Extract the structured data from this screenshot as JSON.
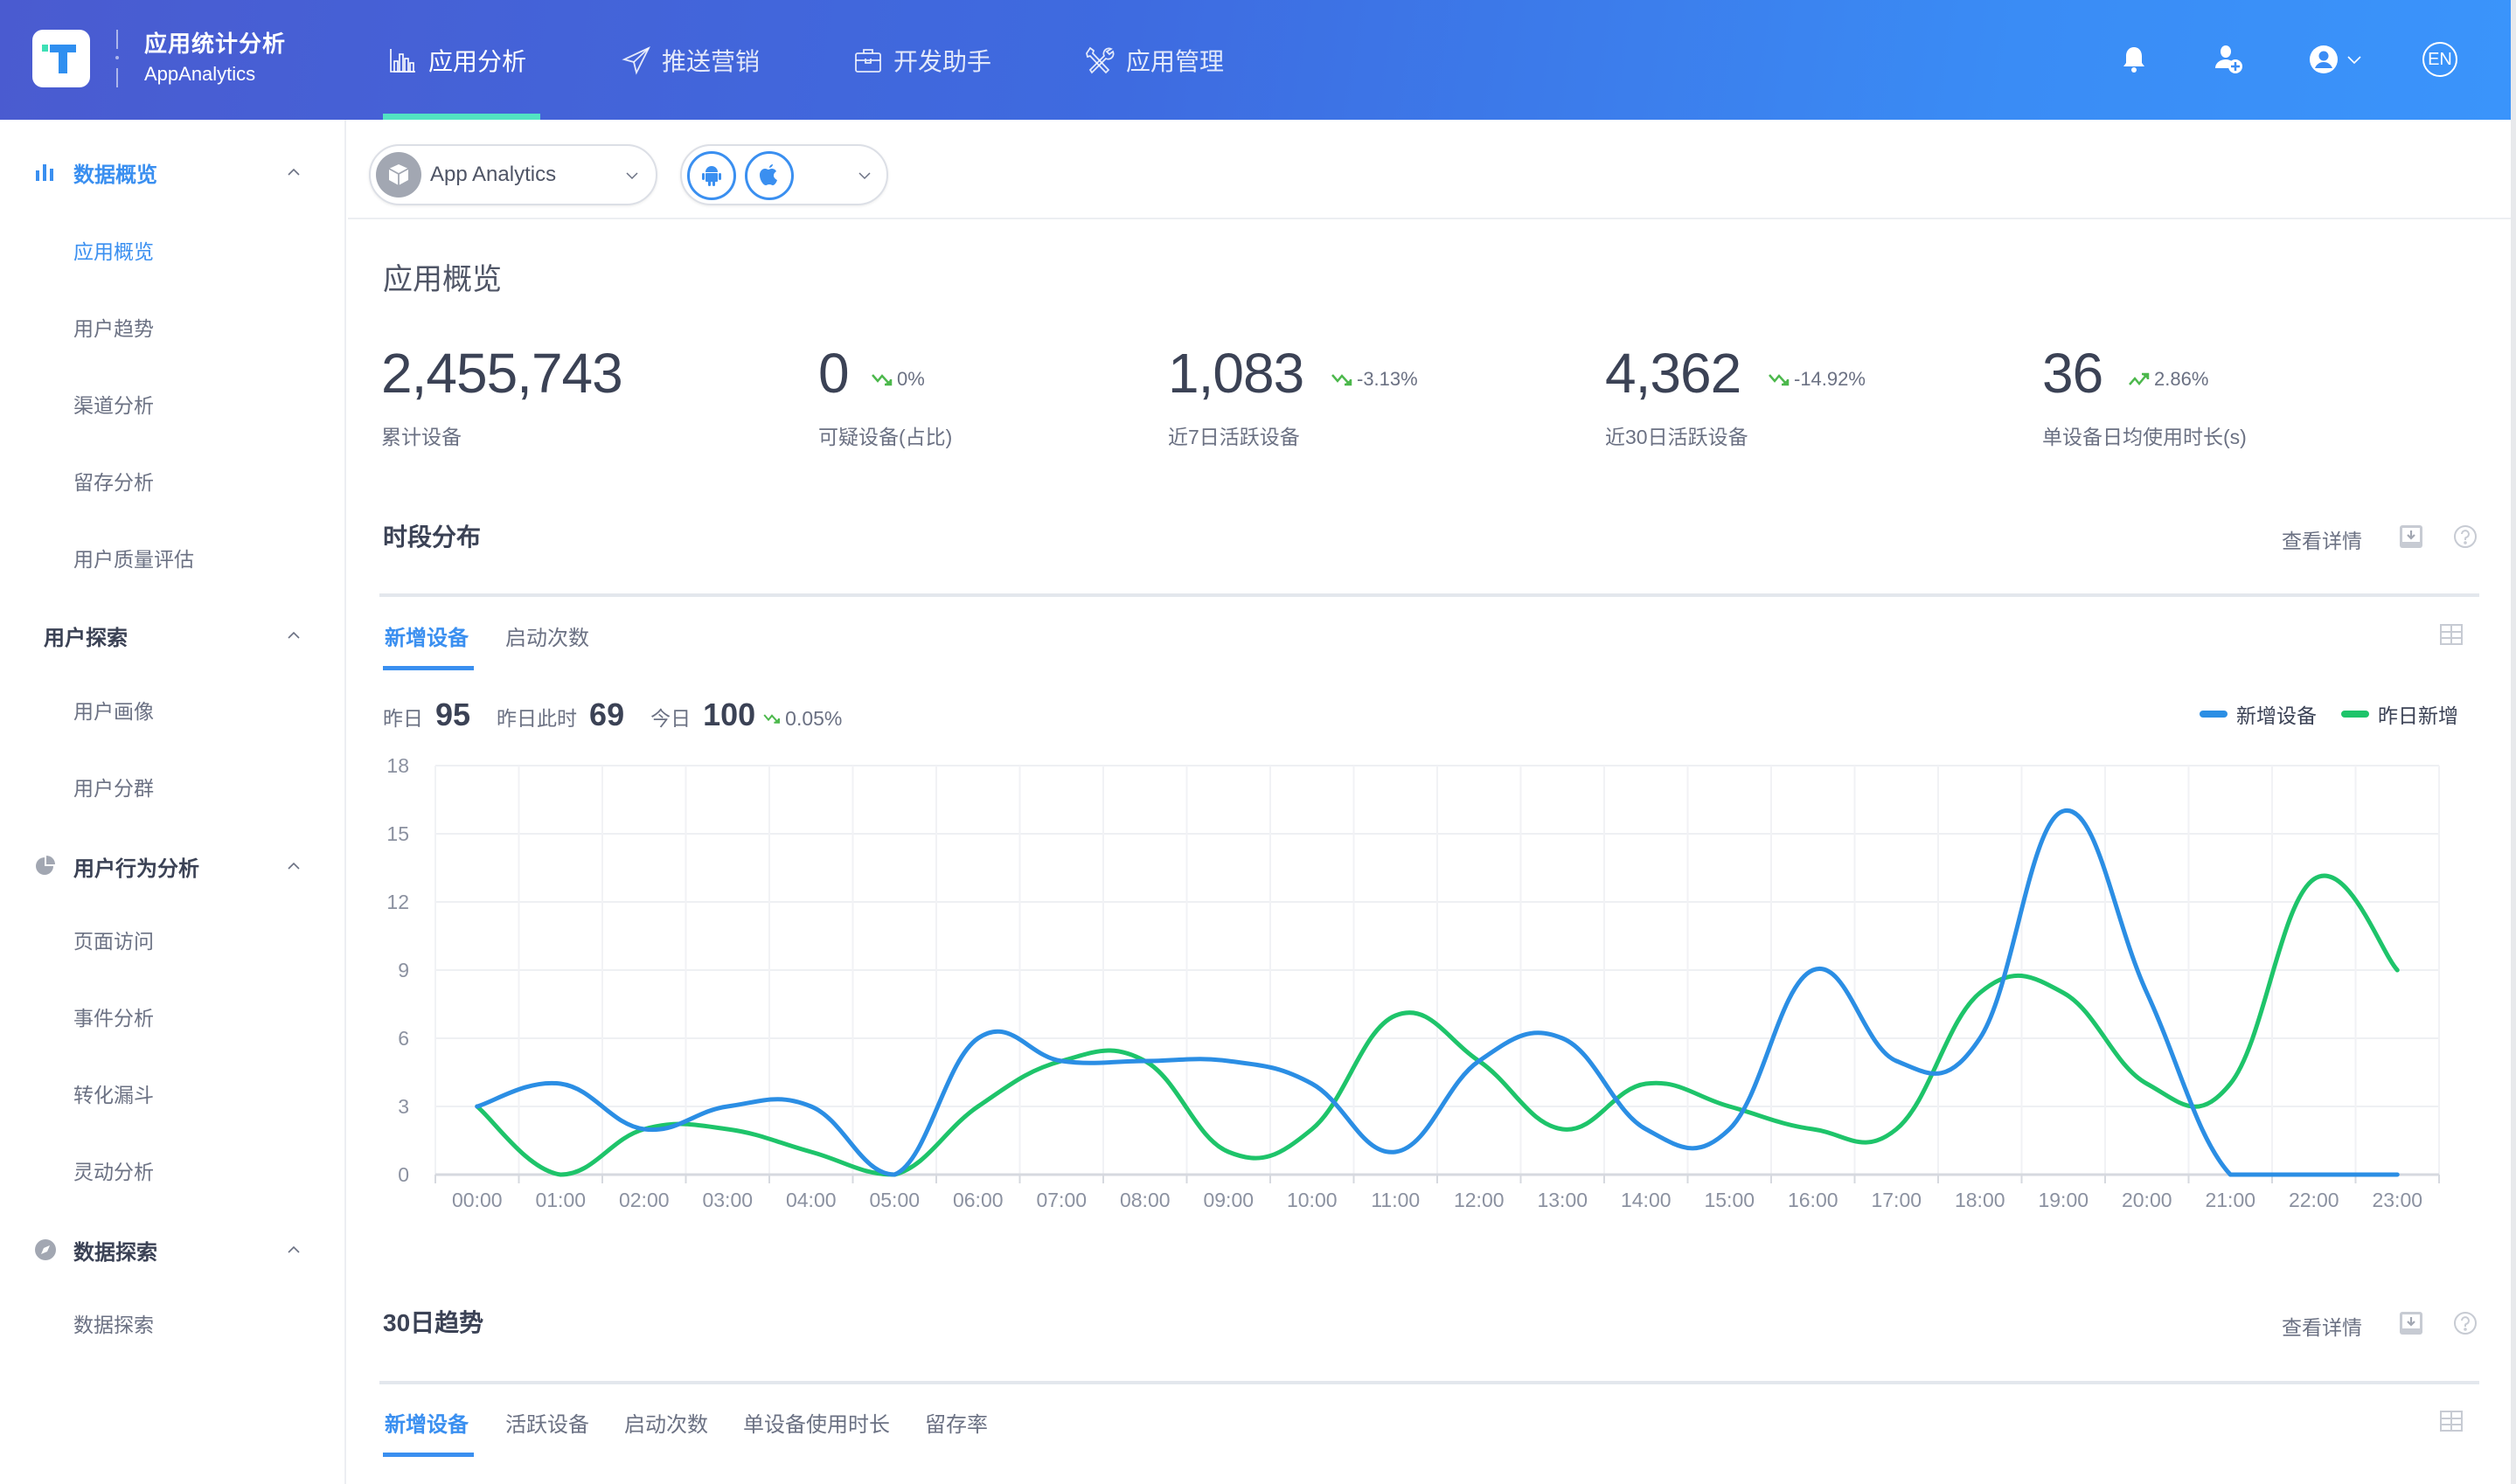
{
  "header": {
    "brand_title": "应用统计分析",
    "brand_subtitle": "AppAnalytics",
    "nav": [
      {
        "label": "应用分析",
        "icon": "bar-chart-icon",
        "active": true
      },
      {
        "label": "推送营销",
        "icon": "paper-plane-icon",
        "active": false
      },
      {
        "label": "开发助手",
        "icon": "briefcase-icon",
        "active": false
      },
      {
        "label": "应用管理",
        "icon": "tools-icon",
        "active": false
      }
    ],
    "actions": {
      "notifications": "bell-icon",
      "add_user": "add-user-icon",
      "account": "user-circle-icon",
      "language": "EN"
    },
    "accent_color": "#52e3c2"
  },
  "sidebar": {
    "groups": [
      {
        "label": "数据概览",
        "icon": "bar-chart-icon",
        "active": true,
        "items": [
          {
            "label": "应用概览",
            "active": true
          },
          {
            "label": "用户趋势"
          },
          {
            "label": "渠道分析"
          },
          {
            "label": "留存分析"
          },
          {
            "label": "用户质量评估"
          }
        ]
      },
      {
        "label": "用户探索",
        "icon": null,
        "items": [
          {
            "label": "用户画像"
          },
          {
            "label": "用户分群"
          }
        ]
      },
      {
        "label": "用户行为分析",
        "icon": "pie-chart-icon",
        "items": [
          {
            "label": "页面访问"
          },
          {
            "label": "事件分析"
          },
          {
            "label": "转化漏斗"
          },
          {
            "label": "灵动分析"
          }
        ]
      },
      {
        "label": "数据探索",
        "icon": "compass-icon",
        "items": [
          {
            "label": "数据探索"
          }
        ]
      }
    ]
  },
  "toolbar": {
    "app_selector": {
      "value": "App Analytics",
      "icon": "package-icon"
    },
    "platform_selector": {
      "platforms": [
        "android-icon",
        "apple-icon"
      ]
    }
  },
  "page": {
    "title": "应用概览",
    "stats": [
      {
        "value": "2,455,743",
        "label": "累计设备",
        "change": null,
        "direction": null
      },
      {
        "value": "0",
        "label": "可疑设备(占比)",
        "change": "0%",
        "direction": "down"
      },
      {
        "value": "1,083",
        "label": "近7日活跃设备",
        "change": "-3.13%",
        "direction": "down"
      },
      {
        "value": "4,362",
        "label": "近30日活跃设备",
        "change": "-14.92%",
        "direction": "down"
      },
      {
        "value": "36",
        "label": "单设备日均使用时长(s)",
        "change": "2.86%",
        "direction": "up"
      }
    ],
    "trend_color": "#4cb84c"
  },
  "hourly": {
    "title": "时段分布",
    "details_link": "查看详情",
    "tabs": [
      {
        "label": "新增设备",
        "active": true
      },
      {
        "label": "启动次数",
        "active": false
      }
    ],
    "summary": {
      "yesterday_label": "昨日",
      "yesterday_value": "95",
      "yesterday_now_label": "昨日此时",
      "yesterday_now_value": "69",
      "today_label": "今日",
      "today_value": "100",
      "change": "0.05%",
      "direction": "down"
    }
  },
  "trend30": {
    "title": "30日趋势",
    "details_link": "查看详情",
    "tabs": [
      {
        "label": "新增设备",
        "active": true
      },
      {
        "label": "活跃设备",
        "active": false
      },
      {
        "label": "启动次数",
        "active": false
      },
      {
        "label": "单设备使用时长",
        "active": false
      },
      {
        "label": "留存率",
        "active": false
      }
    ]
  },
  "chart_data": {
    "type": "line",
    "title": "时段分布",
    "xlabel": "",
    "ylabel": "",
    "x": [
      "00:00",
      "01:00",
      "02:00",
      "03:00",
      "04:00",
      "05:00",
      "06:00",
      "07:00",
      "08:00",
      "09:00",
      "10:00",
      "11:00",
      "12:00",
      "13:00",
      "14:00",
      "15:00",
      "16:00",
      "17:00",
      "18:00",
      "19:00",
      "20:00",
      "21:00",
      "22:00",
      "23:00"
    ],
    "series": [
      {
        "name": "新增设备",
        "color": "#2b8ee4",
        "values": [
          3,
          4,
          2,
          3,
          3,
          0,
          6,
          5,
          5,
          5,
          4,
          1,
          5,
          6,
          2,
          2,
          9,
          5,
          6,
          16,
          8,
          0,
          0,
          0
        ]
      },
      {
        "name": "昨日新增",
        "color": "#1ec46a",
        "values": [
          3,
          0,
          2,
          2,
          1,
          0,
          3,
          5,
          5,
          1,
          2,
          7,
          5,
          2,
          4,
          3,
          2,
          2,
          8,
          8,
          4,
          4,
          13,
          9
        ]
      }
    ],
    "ylim": [
      0,
      18
    ],
    "yticks": [
      0,
      3,
      6,
      9,
      12,
      15,
      18
    ],
    "grid": true,
    "smooth": true,
    "legend": "top-right"
  }
}
